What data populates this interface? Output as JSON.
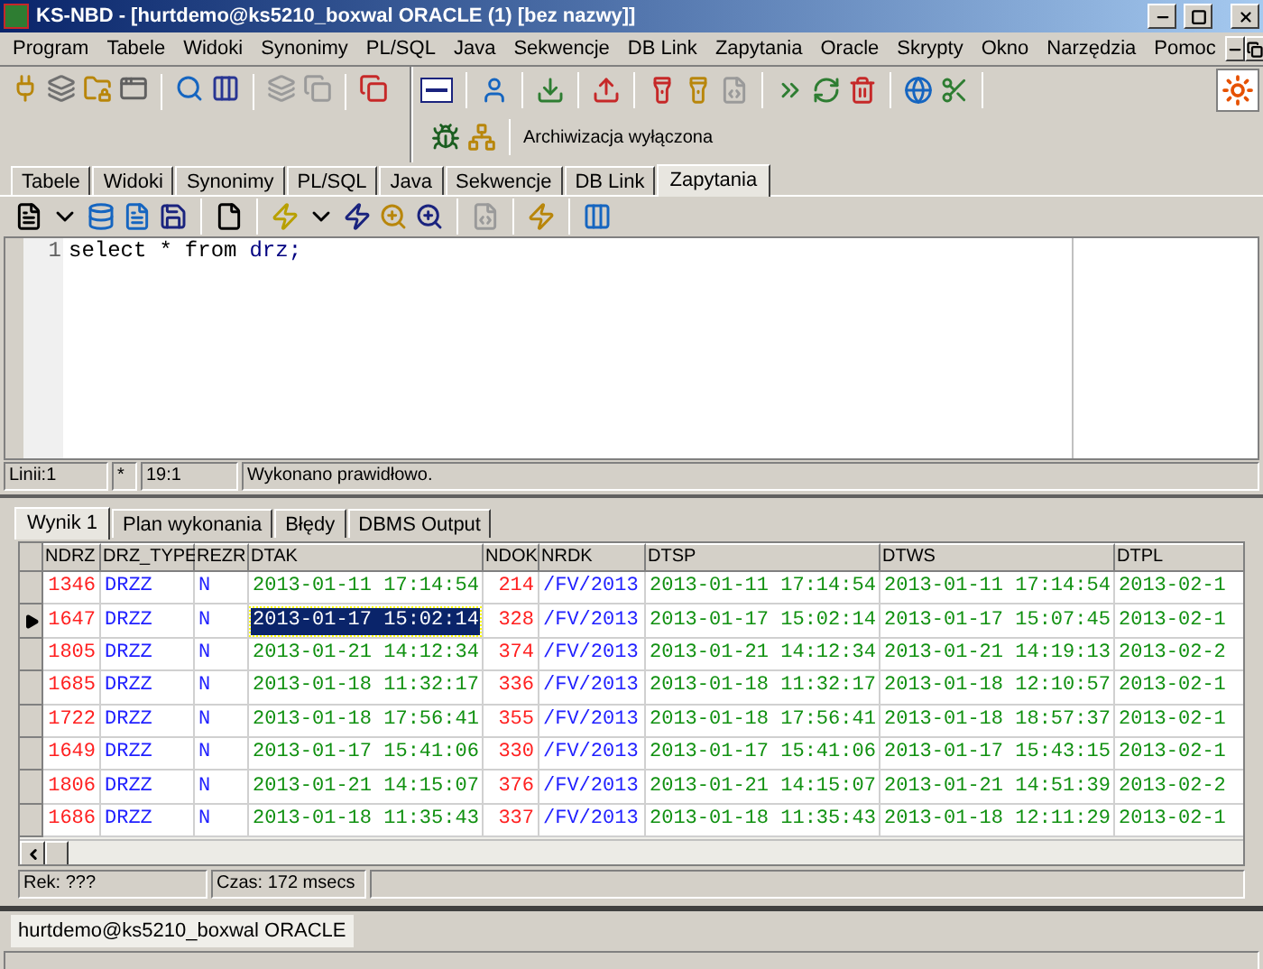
{
  "window": {
    "title": "KS-NBD - [hurtdemo@ks5210_boxwal ORACLE (1) [bez nazwy]]"
  },
  "menu": [
    "Program",
    "Tabele",
    "Widoki",
    "Synonimy",
    "PL/SQL",
    "Java",
    "Sekwencje",
    "DB Link",
    "Zapytania",
    "Oracle",
    "Skrypty",
    "Okno",
    "Narzędzia",
    "Pomoc"
  ],
  "toolbar": {
    "status_text": "Archiwizacja wyłączona"
  },
  "tabs": [
    {
      "label": "Tabele",
      "selected": false
    },
    {
      "label": "Widoki",
      "selected": false
    },
    {
      "label": "Synonimy",
      "selected": false
    },
    {
      "label": "PL/SQL",
      "selected": false
    },
    {
      "label": "Java",
      "selected": false
    },
    {
      "label": "Sekwencje",
      "selected": false
    },
    {
      "label": "DB Link",
      "selected": false
    },
    {
      "label": "Zapytania",
      "selected": true
    }
  ],
  "editor": {
    "lines": [
      {
        "number": "1",
        "tokens": [
          {
            "text": "select",
            "kind": "keyword"
          },
          {
            "text": "*",
            "kind": "keyword"
          },
          {
            "text": "from",
            "kind": "keyword"
          },
          {
            "text": "drz;",
            "kind": "identifier"
          }
        ]
      }
    ]
  },
  "editor_status": {
    "lines": "Linii:1",
    "modified": "*",
    "position": "19:1",
    "message": "Wykonano prawidłowo."
  },
  "result_tabs": [
    {
      "label": "Wynik 1",
      "selected": true
    },
    {
      "label": "Plan wykonania",
      "selected": false
    },
    {
      "label": "Błędy",
      "selected": false
    },
    {
      "label": "DBMS Output",
      "selected": false
    }
  ],
  "grid": {
    "columns": [
      {
        "label": "NDRZ",
        "kind": "number",
        "focused": false
      },
      {
        "label": "DRZ_TYPE",
        "kind": "text",
        "focused": false
      },
      {
        "label": "REZR",
        "kind": "text",
        "focused": false
      },
      {
        "label": "DTAK",
        "kind": "date",
        "focused": true
      },
      {
        "label": "NDOK",
        "kind": "number",
        "focused": false
      },
      {
        "label": "NRDK",
        "kind": "text",
        "focused": false
      },
      {
        "label": "DTSP",
        "kind": "date",
        "focused": false
      },
      {
        "label": "DTWS",
        "kind": "date",
        "focused": false
      },
      {
        "label": "DTPL",
        "kind": "date",
        "focused": false
      }
    ],
    "rows": [
      {
        "selected": false,
        "cells": [
          "1346",
          "DRZZ",
          "N",
          "2013-01-11 17:14:54",
          "214",
          "/FV/2013",
          "2013-01-11 17:14:54",
          "2013-01-11 17:14:54",
          "2013-02-1"
        ]
      },
      {
        "selected": true,
        "cells": [
          "1647",
          "DRZZ",
          "N",
          "2013-01-17 15:02:14",
          "328",
          "/FV/2013",
          "2013-01-17 15:02:14",
          "2013-01-17 15:07:45",
          "2013-02-1"
        ]
      },
      {
        "selected": false,
        "cells": [
          "1805",
          "DRZZ",
          "N",
          "2013-01-21 14:12:34",
          "374",
          "/FV/2013",
          "2013-01-21 14:12:34",
          "2013-01-21 14:19:13",
          "2013-02-2"
        ]
      },
      {
        "selected": false,
        "cells": [
          "1685",
          "DRZZ",
          "N",
          "2013-01-18 11:32:17",
          "336",
          "/FV/2013",
          "2013-01-18 11:32:17",
          "2013-01-18 12:10:57",
          "2013-02-1"
        ]
      },
      {
        "selected": false,
        "cells": [
          "1722",
          "DRZZ",
          "N",
          "2013-01-18 17:56:41",
          "355",
          "/FV/2013",
          "2013-01-18 17:56:41",
          "2013-01-18 18:57:37",
          "2013-02-1"
        ]
      },
      {
        "selected": false,
        "cells": [
          "1649",
          "DRZZ",
          "N",
          "2013-01-17 15:41:06",
          "330",
          "/FV/2013",
          "2013-01-17 15:41:06",
          "2013-01-17 15:43:15",
          "2013-02-1"
        ]
      },
      {
        "selected": false,
        "cells": [
          "1806",
          "DRZZ",
          "N",
          "2013-01-21 14:15:07",
          "376",
          "/FV/2013",
          "2013-01-21 14:15:07",
          "2013-01-21 14:51:39",
          "2013-02-2"
        ]
      },
      {
        "selected": false,
        "cells": [
          "1686",
          "DRZZ",
          "N",
          "2013-01-18 11:35:43",
          "337",
          "/FV/2013",
          "2013-01-18 11:35:43",
          "2013-01-18 12:11:29",
          "2013-02-1"
        ]
      }
    ]
  },
  "result_status": {
    "records": "Rek: ???",
    "time": "Czas: 172 msecs"
  },
  "connection_tabs": [
    {
      "label": "hurtdemo@ks5210_boxwal ORACLE",
      "selected": true
    }
  ]
}
